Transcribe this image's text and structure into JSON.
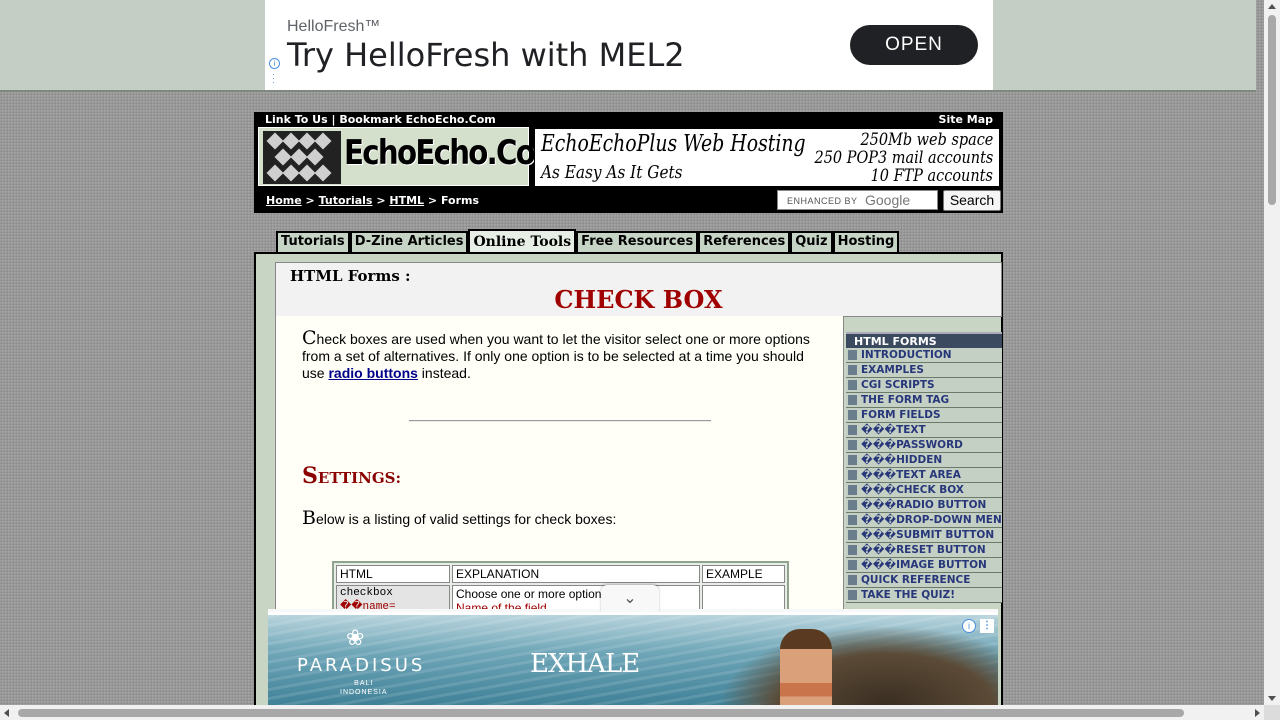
{
  "top_ad": {
    "sponsor": "HelloFresh™",
    "headline": "Try HelloFresh with MEL2",
    "cta": "OPEN"
  },
  "header": {
    "top_links": "Link To Us | Bookmark EchoEcho.Com",
    "site_map": "Site Map",
    "logo_text": "EchoEcho.Com",
    "logo_mark": "ECHO ECHO .COM",
    "hosting_ad": {
      "title": "EchoEchoPlus Web Hosting",
      "tagline": "As Easy As It Gets",
      "feature_1": "250Mb web space",
      "feature_2": "250 POP3 mail accounts",
      "feature_3": "10 FTP accounts"
    },
    "breadcrumb": {
      "home": "Home",
      "tutorials": "Tutorials",
      "html": "HTML",
      "current": "Forms",
      "sep": ">"
    },
    "search": {
      "enhanced_label": "ENHANCED BY",
      "google": "Google",
      "button": "Search"
    }
  },
  "tabs": [
    {
      "label": "Tutorials",
      "active": false
    },
    {
      "label": "D-Zine Articles",
      "active": false
    },
    {
      "label": "Online Tools",
      "active": true
    },
    {
      "label": "Free Resources",
      "active": false
    },
    {
      "label": "References",
      "active": false
    },
    {
      "label": "Quiz",
      "active": false
    },
    {
      "label": "Hosting",
      "active": false
    }
  ],
  "page": {
    "section": "HTML Forms :",
    "title": "CHECK BOX",
    "intro_dropcap": "C",
    "intro_before_link": "heck boxes are used when you want to let the visitor select one or more options from a set of alternatives. If only one option is to be selected at a time you should use ",
    "intro_link": "radio buttons",
    "intro_after_link": " instead.",
    "settings_first": "S",
    "settings_rest": "ETTINGS:",
    "listing_dropcap": "B",
    "listing_rest": "elow is a listing of valid settings for check boxes:",
    "table": {
      "headers": [
        "HTML",
        "EXPLANATION",
        "EXAMPLE"
      ],
      "row1": {
        "html": "checkbox",
        "html_attr": "��name=",
        "expl": "Choose one or more options",
        "expl2": "Name of the field.",
        "example": ""
      }
    }
  },
  "sidebar": {
    "heading": "HTML FORMS",
    "items": [
      "INTRODUCTION",
      "EXAMPLES",
      "CGI SCRIPTS",
      "THE FORM TAG",
      "FORM FIELDS",
      "���TEXT",
      "���PASSWORD",
      "���HIDDEN",
      "���TEXT AREA",
      "���CHECK BOX",
      "���RADIO BUTTON",
      "���DROP-DOWN MENU",
      "���SUBMIT BUTTON",
      "���RESET BUTTON",
      "���IMAGE BUTTON",
      "QUICK REFERENCE",
      "TAKE THE QUIZ!"
    ]
  },
  "bottom_ad": {
    "brand": "PARADISUS",
    "brand_sub_1": "BALI",
    "brand_sub_2": "INDONESIA",
    "headline": "EXHALE"
  }
}
